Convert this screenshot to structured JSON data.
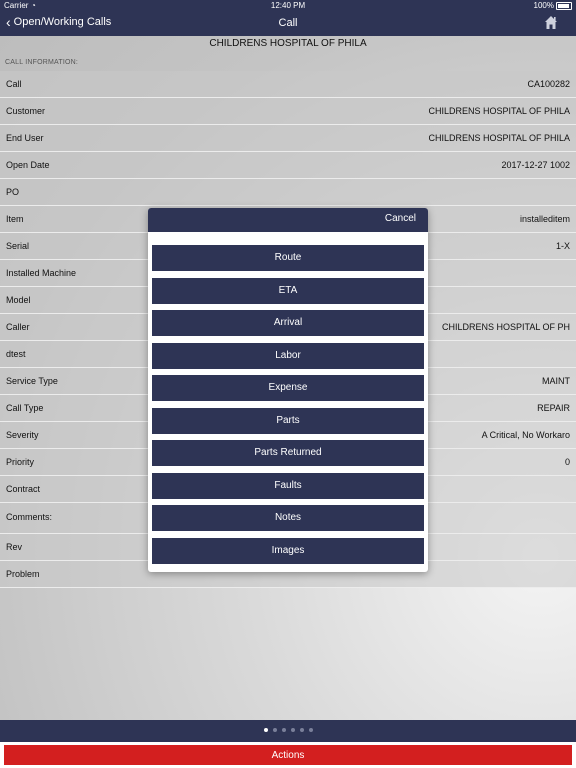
{
  "status_bar": {
    "carrier": "Carrier",
    "time": "12:40 PM",
    "battery": "100%"
  },
  "nav": {
    "back_label": "Open/Working Calls",
    "title": "Call"
  },
  "customer_header": "CHILDRENS HOSPITAL OF PHILA",
  "section_label": "CALL INFORMATION:",
  "fields": [
    {
      "label": "Call",
      "value": "CA100282"
    },
    {
      "label": "Customer",
      "value": "CHILDRENS HOSPITAL OF PHILA"
    },
    {
      "label": "End User",
      "value": "CHILDRENS HOSPITAL OF PHILA"
    },
    {
      "label": "Open Date",
      "value": "2017-12-27 1002"
    },
    {
      "label": "PO",
      "value": ""
    },
    {
      "label": "Item",
      "value": "installeditem"
    },
    {
      "label": "Serial",
      "value": "1-X"
    },
    {
      "label": "Installed Machine",
      "value": ""
    },
    {
      "label": "Model",
      "value": ""
    },
    {
      "label": "Caller",
      "value": "CHILDRENS HOSPITAL OF PH"
    },
    {
      "label": "dtest",
      "value": ""
    },
    {
      "label": "Service Type",
      "value": "MAINT"
    },
    {
      "label": "Call Type",
      "value": "REPAIR"
    },
    {
      "label": "Severity",
      "value": "A Critical, No Workaro"
    },
    {
      "label": "Priority",
      "value": "0"
    },
    {
      "label": "Contract",
      "value": ""
    },
    {
      "label": "Comments:",
      "value": ""
    },
    {
      "label": "Rev",
      "value": ""
    },
    {
      "label": "Problem",
      "value": ""
    }
  ],
  "modal": {
    "cancel_label": "Cancel",
    "options": [
      "Route",
      "ETA",
      "Arrival",
      "Labor",
      "Expense",
      "Parts",
      "Parts Returned",
      "Faults",
      "Notes",
      "Images"
    ]
  },
  "pager": {
    "count": 6,
    "active_index": 0
  },
  "actions_label": "Actions",
  "colors": {
    "nav": "#2e3455",
    "actions": "#d31f1f"
  }
}
